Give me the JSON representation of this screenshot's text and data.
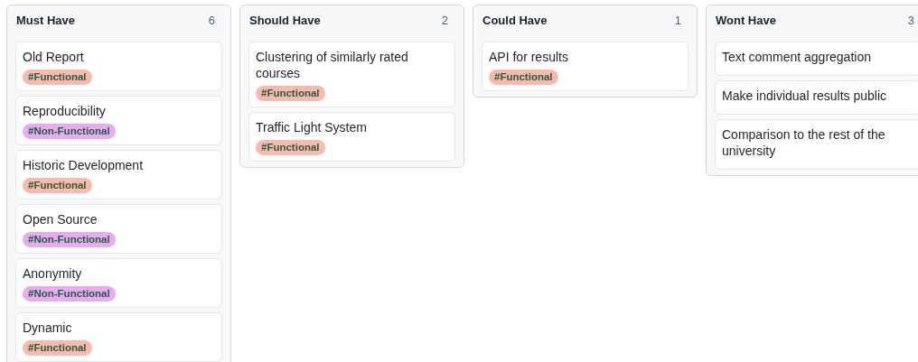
{
  "columns": [
    {
      "title": "Must Have",
      "count": "6",
      "cards": [
        {
          "title": "Old Report",
          "tags": [
            {
              "label": "#Functional",
              "color": "#fbb8ac"
            }
          ]
        },
        {
          "title": "Reproducibility",
          "tags": [
            {
              "label": "#Non-Functional",
              "color": "#e8aaf0"
            }
          ]
        },
        {
          "title": "Historic Development",
          "tags": [
            {
              "label": "#Functional",
              "color": "#fbb8ac"
            }
          ]
        },
        {
          "title": "Open Source",
          "tags": [
            {
              "label": "#Non-Functional",
              "color": "#e8aaf0"
            }
          ]
        },
        {
          "title": "Anonymity",
          "tags": [
            {
              "label": "#Non-Functional",
              "color": "#e8aaf0"
            }
          ]
        },
        {
          "title": "Dynamic",
          "tags": [
            {
              "label": "#Functional",
              "color": "#fbb8ac"
            }
          ]
        }
      ]
    },
    {
      "title": "Should Have",
      "count": "2",
      "cards": [
        {
          "title": "Clustering of similarly rated courses",
          "tags": [
            {
              "label": "#Functional",
              "color": "#fbb8ac"
            }
          ]
        },
        {
          "title": "Traffic Light System",
          "tags": [
            {
              "label": "#Functional",
              "color": "#fbb8ac"
            }
          ]
        }
      ]
    },
    {
      "title": "Could Have",
      "count": "1",
      "cards": [
        {
          "title": "API for results",
          "tags": [
            {
              "label": "#Functional",
              "color": "#fbb8ac"
            }
          ]
        }
      ]
    },
    {
      "title": "Wont Have",
      "count": "3",
      "cards": [
        {
          "title": "Text comment aggregation"
        },
        {
          "title": "Make individual results public"
        },
        {
          "title": "Comparison to the rest of the university"
        }
      ]
    }
  ]
}
